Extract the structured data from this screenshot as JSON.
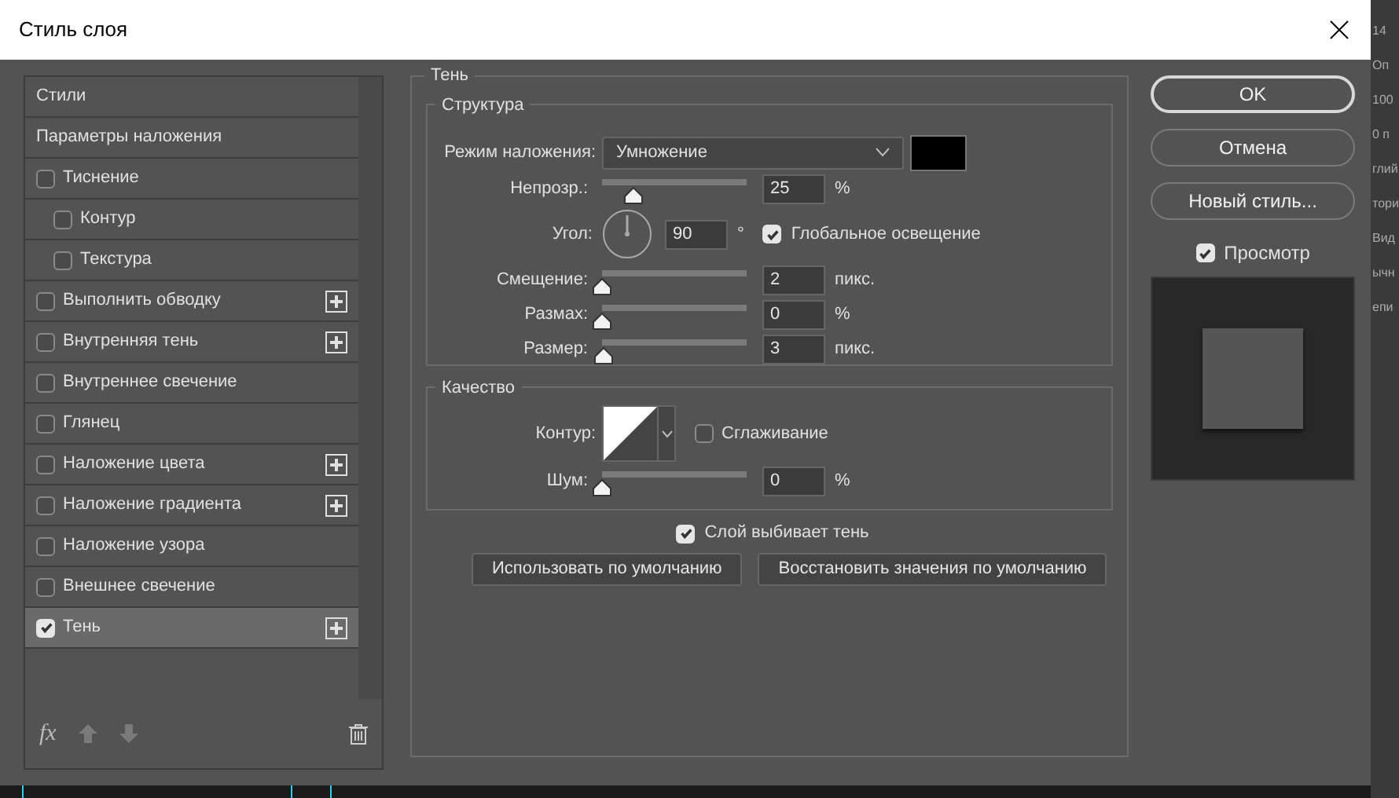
{
  "dialog": {
    "title": "Стиль слоя"
  },
  "styles_list": {
    "items": [
      {
        "kind": "header",
        "label": "Стили",
        "selected": false
      },
      {
        "kind": "header",
        "label": "Параметры наложения",
        "selected": false
      },
      {
        "kind": "effect",
        "label": "Тиснение",
        "checked": false,
        "selected": false,
        "addable": false,
        "children": [
          {
            "kind": "effect",
            "label": "Контур",
            "checked": false,
            "selected": false,
            "addable": false
          },
          {
            "kind": "effect",
            "label": "Текстура",
            "checked": false,
            "selected": false,
            "addable": false
          }
        ]
      },
      {
        "kind": "effect",
        "label": "Выполнить обводку",
        "checked": false,
        "selected": false,
        "addable": true
      },
      {
        "kind": "effect",
        "label": "Внутренняя тень",
        "checked": false,
        "selected": false,
        "addable": true
      },
      {
        "kind": "effect",
        "label": "Внутреннее свечение",
        "checked": false,
        "selected": false,
        "addable": false
      },
      {
        "kind": "effect",
        "label": "Глянец",
        "checked": false,
        "selected": false,
        "addable": false
      },
      {
        "kind": "effect",
        "label": "Наложение цвета",
        "checked": false,
        "selected": false,
        "addable": true
      },
      {
        "kind": "effect",
        "label": "Наложение градиента",
        "checked": false,
        "selected": false,
        "addable": true
      },
      {
        "kind": "effect",
        "label": "Наложение узора",
        "checked": false,
        "selected": false,
        "addable": false
      },
      {
        "kind": "effect",
        "label": "Внешнее свечение",
        "checked": false,
        "selected": false,
        "addable": false
      },
      {
        "kind": "effect",
        "label": "Тень",
        "checked": true,
        "selected": true,
        "addable": true
      }
    ],
    "fx": "fx"
  },
  "effect_panel": {
    "title": "Тень",
    "structure": {
      "title": "Структура",
      "blend_mode": {
        "label": "Режим наложения:",
        "value": "Умножение",
        "color": "#000000"
      },
      "opacity": {
        "label": "Непрозр.:",
        "level": 0.22,
        "value": "25",
        "unit": "%"
      },
      "angle": {
        "label": "Угол:",
        "value": "90",
        "unit": "°",
        "global_light": {
          "label": "Глобальное освещение",
          "checked": true
        }
      },
      "sliders": [
        {
          "label": "Смещение:",
          "level": 0.0,
          "value": "2",
          "unit": "пикс."
        },
        {
          "label": "Размах:",
          "level": 0.0,
          "value": "0",
          "unit": "%"
        },
        {
          "label": "Размер:",
          "level": 0.01,
          "value": "3",
          "unit": "пикс."
        }
      ]
    },
    "quality": {
      "title": "Качество",
      "contour": {
        "label": "Контур:"
      },
      "anti_alias": {
        "label": "Сглаживание",
        "checked": false
      },
      "noise": {
        "label": "Шум:",
        "level": 0.0,
        "value": "0",
        "unit": "%"
      }
    },
    "knockout": {
      "label": "Слой выбивает тень",
      "checked": true
    },
    "buttons": [
      "Использовать по умолчанию",
      "Восстановить значения по умолчанию"
    ]
  },
  "actions": [
    {
      "label": "OK",
      "default": true
    },
    {
      "label": "Отмена",
      "default": false
    },
    {
      "label": "Новый стиль...",
      "default": false
    }
  ],
  "preview": {
    "label": "Просмотр",
    "checked": true
  },
  "background_fragments": [
    "14",
    "Оп",
    "100",
    "0 п",
    "глий",
    "тори",
    "Вид",
    "ычн",
    "епи"
  ]
}
